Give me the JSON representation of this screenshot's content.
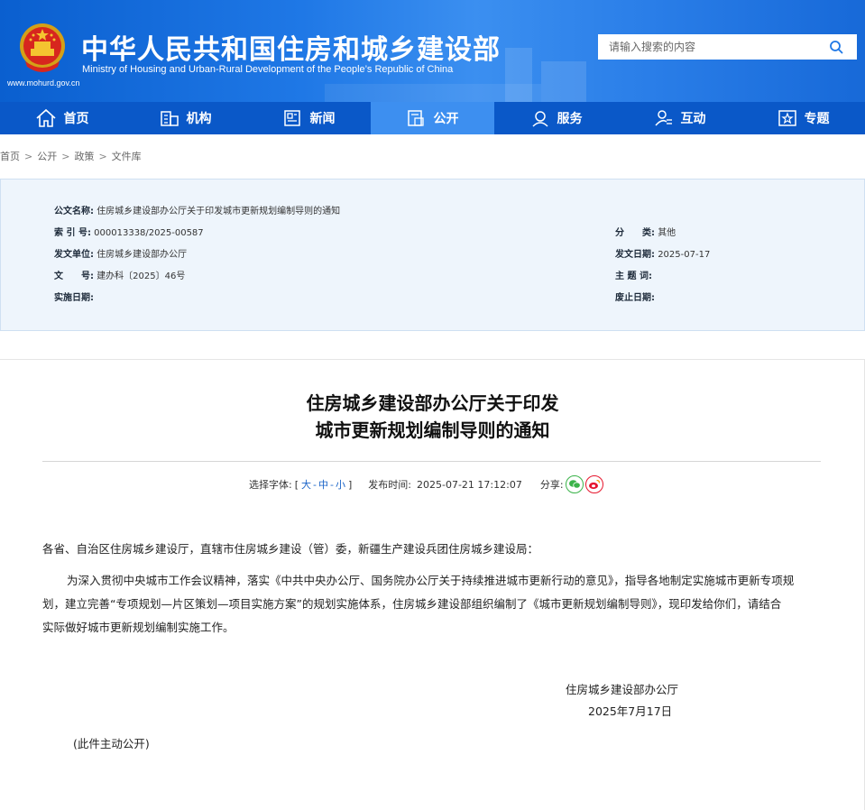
{
  "header": {
    "title": "中华人民共和国住房和城乡建设部",
    "subtitle": "Ministry of Housing and Urban-Rural Development of the People’s Republic of China",
    "url": "www.mohurd.gov.cn",
    "search_placeholder": "请输入搜索的内容"
  },
  "nav": {
    "items": [
      {
        "label": "首页",
        "icon": "home-icon"
      },
      {
        "label": "机构",
        "icon": "building-icon"
      },
      {
        "label": "新闻",
        "icon": "news-icon"
      },
      {
        "label": "公开",
        "icon": "document-icon"
      },
      {
        "label": "服务",
        "icon": "user-service-icon"
      },
      {
        "label": "互动",
        "icon": "interaction-icon"
      },
      {
        "label": "专题",
        "icon": "star-icon"
      }
    ],
    "active": "公开"
  },
  "breadcrumb": [
    "首页",
    "公开",
    "政策",
    "文件库"
  ],
  "breadcrumb_sep": ">",
  "info": {
    "doc_name_label": "公文名称:",
    "doc_name": "住房城乡建设部办公厅关于印发城市更新规划编制导则的通知",
    "index_label": "索 引 号:",
    "index": "000013338/2025-00587",
    "category_label": "分　　类:",
    "category": "其他",
    "issuer_label": "发文单位:",
    "issuer": "住房城乡建设部办公厅",
    "issue_date_label": "发文日期:",
    "issue_date": "2025-07-17",
    "doc_no_label": "文　　号:",
    "doc_no": "建办科〔2025〕46号",
    "keywords_label": "主 题 词:",
    "keywords": "",
    "effective_label": "实施日期:",
    "effective": "",
    "repeal_label": "废止日期:",
    "repeal": ""
  },
  "article": {
    "title_line1": "住房城乡建设部办公厅关于印发",
    "title_line2": "城市更新规划编制导则的通知",
    "font_label": "选择字体:",
    "font_open": "[",
    "font_large": "大",
    "font_mid": "中",
    "font_small": "小",
    "font_sep": "-",
    "font_close": "]",
    "publish_label": "发布时间:",
    "publish_time": "2025-07-21 17:12:07",
    "share_label": "分享:",
    "salutation": "各省、自治区住房城乡建设厅，直辖市住房城乡建设（管）委，新疆生产建设兵团住房城乡建设局：",
    "para1_line1": "为深入贯彻中央城市工作会议精神，落实《中共中央办公厅、国务院办公厅关于持续推进城市更新行动的意见》，指导各地制定实施城市更新专项规",
    "para1_line2": "划，建立完善“专项规划—片区策划—项目实施方案”的规划实施体系，住房城乡建设部组织编制了《城市更新规划编制导则》，现印发给你们，请结合",
    "para1_line3": "实际做好城市更新规划编制实施工作。",
    "signer": "住房城乡建设部办公厅",
    "sign_date": "2025年7月17日",
    "note": "(此件主动公开)"
  },
  "colors": {
    "nav_bg": "#0a58c8",
    "nav_active": "#3d8ff0",
    "header_blue": "#1f78e6",
    "info_bg": "#eef5fc",
    "wechat_green": "#3bb34a",
    "weibo_red": "#e6162d"
  }
}
